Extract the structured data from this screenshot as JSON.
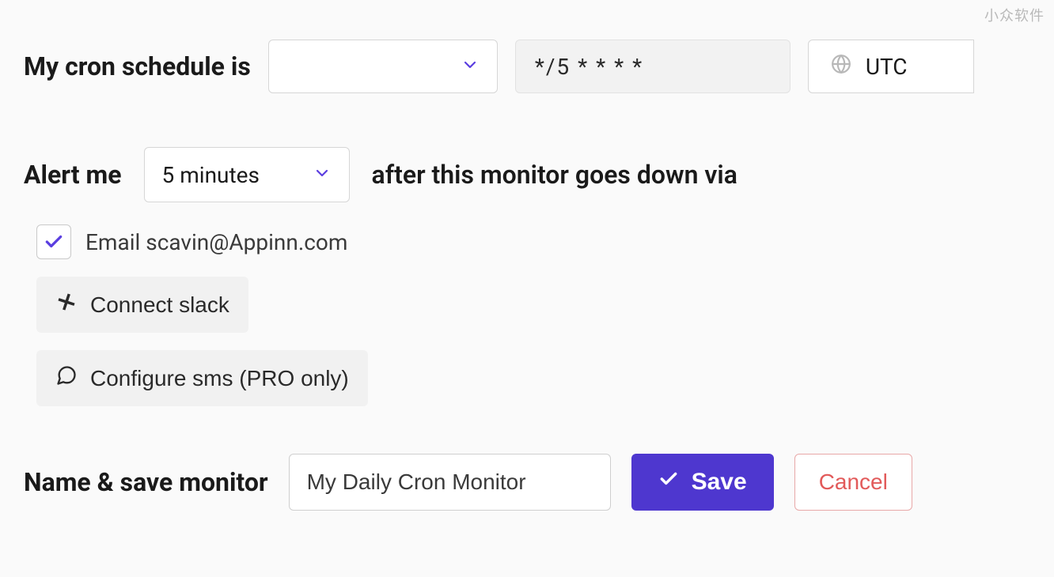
{
  "watermark": "小众软件",
  "schedule": {
    "label": "My cron schedule is",
    "type_selected": "",
    "cron_expression": "*/5 * * * *",
    "timezone": "UTC"
  },
  "alert": {
    "prefix": "Alert me",
    "delay_selected": "5 minutes",
    "suffix": "after this monitor goes down via"
  },
  "channels": {
    "email_label": "Email scavin@Appinn.com",
    "slack_label": "Connect slack",
    "sms_label": "Configure sms (PRO only)"
  },
  "save": {
    "section_label": "Name & save monitor",
    "name_value": "My Daily Cron Monitor",
    "save_label": "Save",
    "cancel_label": "Cancel"
  }
}
